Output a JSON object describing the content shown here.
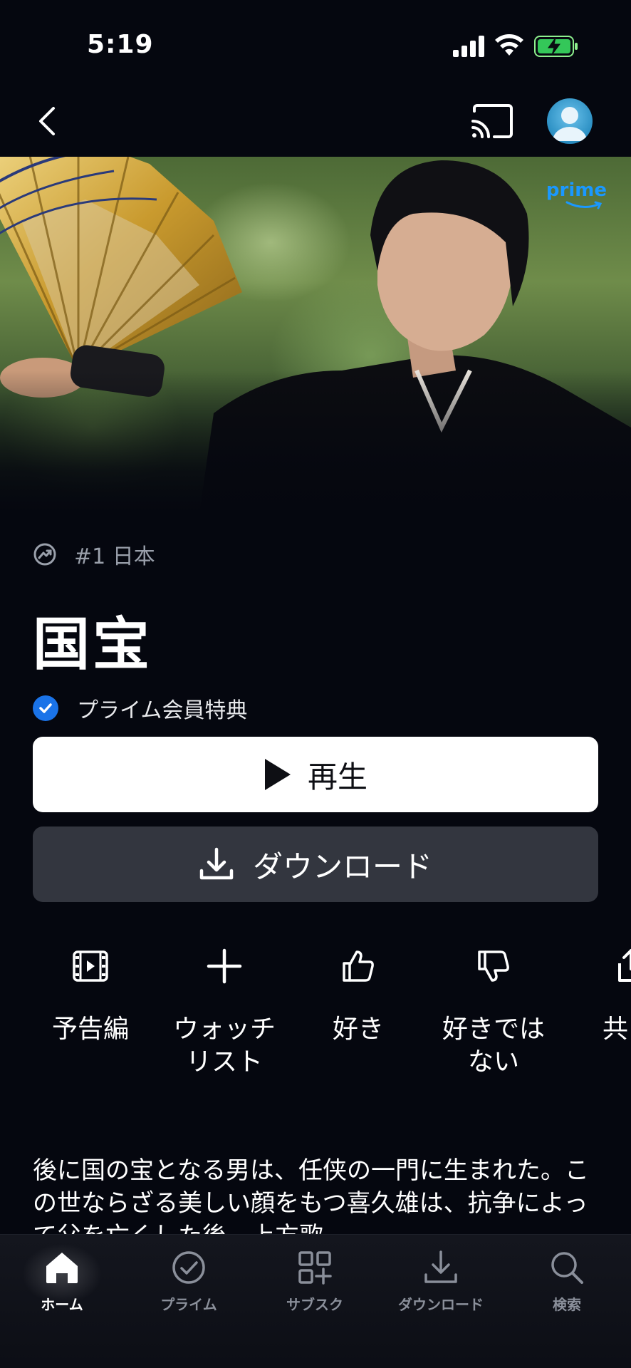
{
  "status_bar": {
    "time": "5:19"
  },
  "hero": {
    "badge": "prime"
  },
  "rank": {
    "label": "#1 日本"
  },
  "title": "国宝",
  "membership": {
    "label": "プライム会員特典"
  },
  "buttons": {
    "play": "再生",
    "download": "ダウンロード"
  },
  "actions": [
    {
      "label": "予告編",
      "icon": "trailer-icon"
    },
    {
      "label": "ウォッチ\nリスト",
      "icon": "plus-icon"
    },
    {
      "label": "好き",
      "icon": "thumbs-up-icon"
    },
    {
      "label": "好きでは\nない",
      "icon": "thumbs-down-icon"
    },
    {
      "label": "共",
      "icon": "share-icon"
    }
  ],
  "description": "後に国の宝となる男は、任侠の一門に生まれた。この世ならざる美しい顔をもつ喜久雄は、抗争によって父を亡くした後、上方歌",
  "bottom_nav": [
    {
      "label": "ホーム",
      "icon": "home-icon",
      "active": true
    },
    {
      "label": "プライム",
      "icon": "prime-check-icon",
      "active": false
    },
    {
      "label": "サブスク",
      "icon": "subscriptions-icon",
      "active": false
    },
    {
      "label": "ダウンロード",
      "icon": "download-icon",
      "active": false
    },
    {
      "label": "検索",
      "icon": "search-icon",
      "active": false
    }
  ],
  "colors": {
    "background": "#05070f",
    "accent_blue": "#1a73e8",
    "prime_blue": "#1a98ff"
  }
}
